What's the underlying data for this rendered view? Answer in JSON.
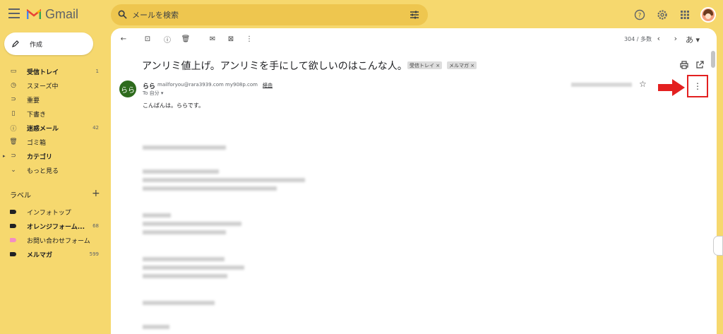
{
  "app": {
    "name": "Gmail"
  },
  "search": {
    "placeholder": "メールを検索"
  },
  "sidebar": {
    "compose_label": "作成",
    "items": [
      {
        "label": "受信トレイ",
        "count": "1",
        "bold": true,
        "icon": "inbox-icon"
      },
      {
        "label": "スヌーズ中",
        "count": "",
        "bold": false,
        "icon": "clock-icon"
      },
      {
        "label": "重要",
        "count": "",
        "bold": false,
        "icon": "important-icon"
      },
      {
        "label": "下書き",
        "count": "",
        "bold": false,
        "icon": "draft-icon"
      },
      {
        "label": "迷惑メール",
        "count": "42",
        "bold": true,
        "icon": "spam-icon"
      },
      {
        "label": "ゴミ箱",
        "count": "",
        "bold": false,
        "icon": "trash-icon"
      },
      {
        "label": "カテゴリ",
        "count": "",
        "bold": true,
        "icon": "label-icon"
      },
      {
        "label": "もっと見る",
        "count": "",
        "bold": false,
        "icon": "chevron-down-icon"
      }
    ],
    "labels_heading": "ラベル",
    "labels": [
      {
        "label": "インフォトップ",
        "count": "",
        "bold": false,
        "color": "#202124"
      },
      {
        "label": "オレンジフォーム...",
        "count": "68",
        "bold": true,
        "color": "#202124"
      },
      {
        "label": "お問い合わせフォーム",
        "count": "",
        "bold": false,
        "color": "#f28dc3"
      },
      {
        "label": "メルマガ",
        "count": "599",
        "bold": true,
        "color": "#202124"
      }
    ]
  },
  "toolbar": {
    "pager": "304 / 多数",
    "input_tool": "あ"
  },
  "email": {
    "subject": "アンリミ値上げ。アンリミを手にして欲しいのはこんな人。",
    "chips": [
      "受信トレイ ×",
      "メルマガ ×"
    ],
    "sender_initials": "らら",
    "sender_name": "らら",
    "sender_email": "mailforyou@rara3939.com my908p.com",
    "via": "経由",
    "to": "To 自分 ▾",
    "greeting": "こんばんは。ららです。"
  },
  "colors": {
    "background": "#f6d86e",
    "search_bg": "#eec64f",
    "highlight": "#e32020",
    "sender_avatar": "#2e6b1d"
  }
}
